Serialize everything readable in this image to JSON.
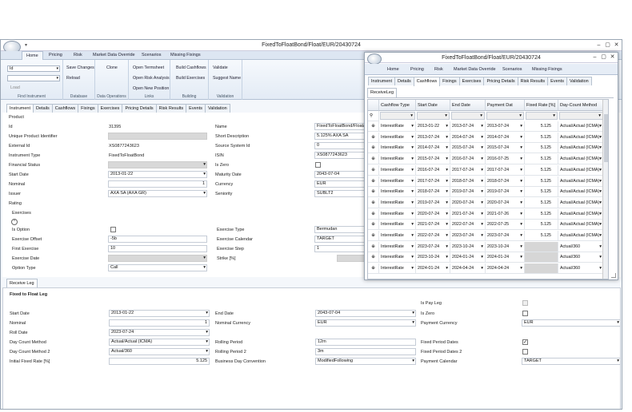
{
  "main": {
    "title": "FixedToFloatBond/Float/EUR/20430724",
    "quick_access": "▾",
    "menu": [
      "Home",
      "Pricing",
      "Risk",
      "Market Data Override",
      "Scenarios",
      "Missing Fixings"
    ],
    "ribbon": {
      "id_select": "Id",
      "load": "Load",
      "groups": [
        "Find Instrument",
        "Database",
        "Data Operations",
        "Links",
        "Building",
        "Validation"
      ],
      "save_changes": "Save Changes",
      "reload": "Reload",
      "clone": "Clone",
      "open_termsheet": "Open Termsheet",
      "open_risk_analysis": "Open Risk Analysis",
      "open_new_position": "Open New Position",
      "build_cashflows": "Build Cashflows",
      "build_exercises": "Build Exercises",
      "validate": "Validate",
      "suggest_name": "Suggest Name"
    },
    "tabs": [
      "Instrument",
      "Details",
      "Cashflows",
      "Fixings",
      "Exercises",
      "Pricing Details",
      "Risk Results",
      "Events",
      "Validation"
    ],
    "product": {
      "section": "Product",
      "id_label": "Id",
      "id_value": "31395",
      "upi_label": "Unique Product Identifier",
      "extid_label": "External Id",
      "extid_value": "XS0877243623",
      "itype_label": "Instrument Type",
      "itype_value": "FixedToFloatBond",
      "fs_label": "Financial Status",
      "start_label": "Start Date",
      "start_value": "2013-01-22",
      "nominal_label": "Nominal",
      "nominal_value": "1",
      "issuer_label": "Issuer",
      "issuer_value": "AXA SA (AXA GR)",
      "rating_label": "Rating",
      "name_label": "Name",
      "name_value": "FixedToFloatBond/Float/EUR/20430724",
      "sdesc_label": "Short Description",
      "sdesc_value": "5.125% AXA SA",
      "ssid_label": "Source System Id",
      "ssid_value": "0",
      "isin_label": "ISIN",
      "isin_value": "XS0877243623",
      "iszero_label": "Is Zero",
      "mat_label": "Maturity Date",
      "mat_value": "2043-07-04",
      "ccy_label": "Currency",
      "ccy_value": "EUR",
      "sen_label": "Seniority",
      "sen_value": "SUBLT2"
    },
    "exercises": {
      "section": "Exercises",
      "isopt_label": "Is Option",
      "offset_label": "Exercise Offset",
      "offset_value": "-5b",
      "first_label": "First Exercise",
      "first_value": "10",
      "exdate_label": "Exercise Date",
      "opttype_label": "Option Type",
      "opttype_value": "Call",
      "extype_label": "Exercise Type",
      "extype_value": "Bermudan",
      "excal_label": "Exercise Calendar",
      "excal_value": "TARGET",
      "exstep_label": "Exercise Step",
      "exstep_value": "1",
      "strike_label": "Strike [%]"
    },
    "leg_tab": "Receive Leg",
    "leg": {
      "title": "Fixed to Float Leg",
      "ispay_label": "Is Pay Leg",
      "start_label": "Start Date",
      "start_value": "2013-01-22",
      "nominal_label": "Nominal",
      "nominal_value": "1",
      "roll_label": "Roll Date",
      "roll_value": "2023-07-24",
      "dcm_label": "Day Count Method",
      "dcm_value": "Actual/Actual (ICMA)",
      "dcm2_label": "Day Count Method 2",
      "dcm2_value": "Actual/360",
      "ifr_label": "Initial Fixed Rate [%]",
      "ifr_value": "5.125",
      "end_label": "End Date",
      "end_value": "2043-07-04",
      "nccy_label": "Nominal Currency",
      "nccy_value": "EUR",
      "rp_label": "Rolling Period",
      "rp_value": "12m",
      "rp2_label": "Rolling Period 2",
      "rp2_value": "3m",
      "bdc_label": "Business Day Convention",
      "bdc_value": "ModifiedFollowing",
      "iszero_label": "Is Zero",
      "pccy_label": "Payment Currency",
      "pccy_value": "EUR",
      "fpd_label": "Fixed Period Dates",
      "fpd2_label": "Fixed Period Dates 2",
      "pcal_label": "Payment Calendar",
      "pcal_value": "TARGET"
    }
  },
  "second": {
    "title": "FixedToFloatBond/Float/EUR/20430724",
    "menu": [
      "Home",
      "Pricing",
      "Risk",
      "Market Data Override",
      "Scenarios",
      "Missing Fixings"
    ],
    "tabs": [
      "Instrument",
      "Details",
      "Cashflows",
      "Fixings",
      "Exercises",
      "Pricing Details",
      "Risk Results",
      "Events",
      "Validation"
    ],
    "leg_select": "ReceiveLeg",
    "columns": [
      "Cashflow Type",
      "Start Date",
      "End Date",
      "Payment Dat",
      "Fixed Rate [%]",
      "Day-Count Method"
    ],
    "rows": [
      {
        "type": "InterestRate",
        "start": "2013-01-22",
        "end": "2013-07-24",
        "pay": "2013-07-24",
        "rate": "5.125",
        "dcm": "Actual/Actual (ICMA)"
      },
      {
        "type": "InterestRate",
        "start": "2013-07-24",
        "end": "2014-07-24",
        "pay": "2014-07-24",
        "rate": "5.125",
        "dcm": "Actual/Actual (ICMA)"
      },
      {
        "type": "InterestRate",
        "start": "2014-07-24",
        "end": "2015-07-24",
        "pay": "2015-07-24",
        "rate": "5.125",
        "dcm": "Actual/Actual (ICMA)"
      },
      {
        "type": "InterestRate",
        "start": "2015-07-24",
        "end": "2016-07-24",
        "pay": "2016-07-25",
        "rate": "5.125",
        "dcm": "Actual/Actual (ICMA)"
      },
      {
        "type": "InterestRate",
        "start": "2016-07-24",
        "end": "2017-07-24",
        "pay": "2017-07-24",
        "rate": "5.125",
        "dcm": "Actual/Actual (ICMA)"
      },
      {
        "type": "InterestRate",
        "start": "2017-07-24",
        "end": "2018-07-24",
        "pay": "2018-07-24",
        "rate": "5.125",
        "dcm": "Actual/Actual (ICMA)"
      },
      {
        "type": "InterestRate",
        "start": "2018-07-24",
        "end": "2019-07-24",
        "pay": "2019-07-24",
        "rate": "5.125",
        "dcm": "Actual/Actual (ICMA)"
      },
      {
        "type": "InterestRate",
        "start": "2019-07-24",
        "end": "2020-07-24",
        "pay": "2020-07-24",
        "rate": "5.125",
        "dcm": "Actual/Actual (ICMA)"
      },
      {
        "type": "InterestRate",
        "start": "2020-07-24",
        "end": "2021-07-24",
        "pay": "2021-07-26",
        "rate": "5.125",
        "dcm": "Actual/Actual (ICMA)"
      },
      {
        "type": "InterestRate",
        "start": "2021-07-24",
        "end": "2022-07-24",
        "pay": "2022-07-25",
        "rate": "5.125",
        "dcm": "Actual/Actual (ICMA)"
      },
      {
        "type": "InterestRate",
        "start": "2022-07-24",
        "end": "2023-07-24",
        "pay": "2023-07-24",
        "rate": "5.125",
        "dcm": "Actual/Actual (ICMA)"
      },
      {
        "type": "InterestRate",
        "start": "2023-07-24",
        "end": "2023-10-24",
        "pay": "2023-10-24",
        "rate": "",
        "dcm": "Actual/360"
      },
      {
        "type": "InterestRate",
        "start": "2023-10-24",
        "end": "2024-01-24",
        "pay": "2024-01-24",
        "rate": "",
        "dcm": "Actual/360"
      },
      {
        "type": "InterestRate",
        "start": "2024-01-24",
        "end": "2024-04-24",
        "pay": "2024-04-24",
        "rate": "",
        "dcm": "Actual/360"
      }
    ]
  }
}
